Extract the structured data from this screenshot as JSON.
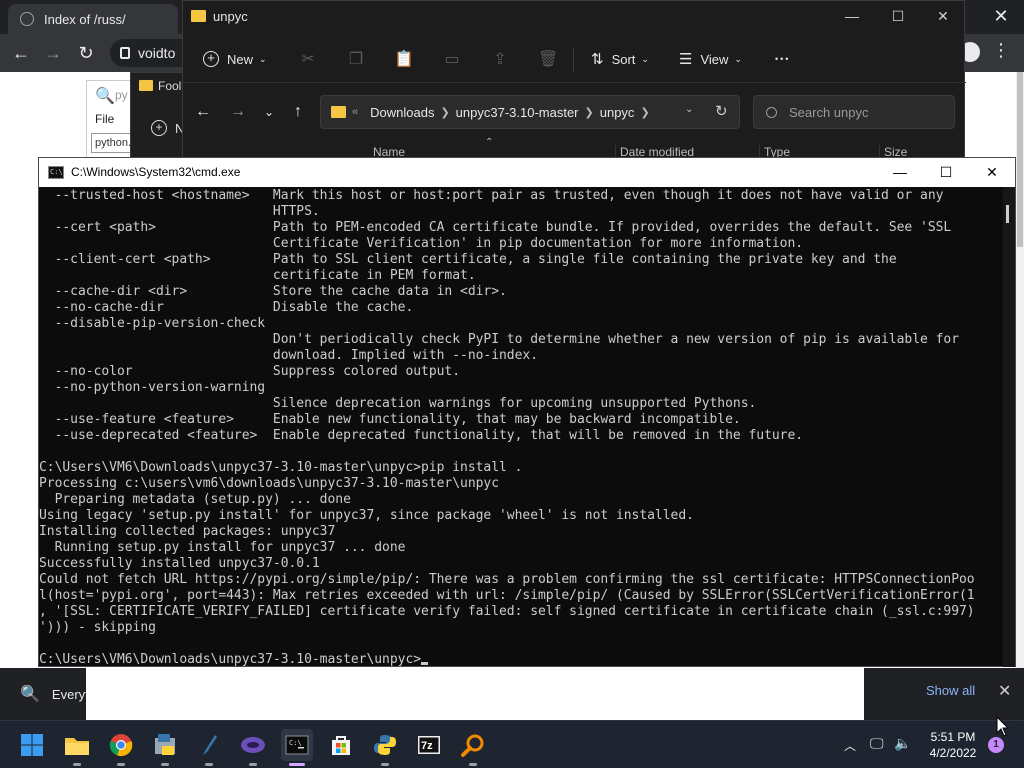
{
  "chrome": {
    "tab_title": "Index of /russ/",
    "address_text": "voidto",
    "close_glyph": "✕",
    "back_glyph": "←",
    "forward_glyph": "→",
    "reload_glyph": "↻",
    "kebab_glyph": "⋮"
  },
  "pyapp": {
    "title": "py",
    "menu_file": "File",
    "field_text": "python."
  },
  "fooapp": {
    "title": "Fool",
    "new_partial": "N"
  },
  "explorer": {
    "title": "unpyc",
    "new_label": "New",
    "sort_label": "Sort",
    "view_label": "View",
    "more_glyph": "•••",
    "breadcrumb_prefix": "«",
    "breadcrumb": [
      "Downloads",
      "unpyc37-3.10-master",
      "unpyc"
    ],
    "search_placeholder": "Search unpyc",
    "columns": [
      "Name",
      "Date modified",
      "Type",
      "Size"
    ],
    "minimize_glyph": "—",
    "maximize_glyph": "☐",
    "close_glyph": "✕"
  },
  "cmd": {
    "title": "C:\\Windows\\System32\\cmd.exe",
    "icon_text": "C:\\",
    "minimize_glyph": "—",
    "maximize_glyph": "☐",
    "close_glyph": "✕",
    "lines": [
      "  --trusted-host <hostname>   Mark this host or host:port pair as trusted, even though it does not have valid or any",
      "                              HTTPS.",
      "  --cert <path>               Path to PEM-encoded CA certificate bundle. If provided, overrides the default. See 'SSL",
      "                              Certificate Verification' in pip documentation for more information.",
      "  --client-cert <path>        Path to SSL client certificate, a single file containing the private key and the",
      "                              certificate in PEM format.",
      "  --cache-dir <dir>           Store the cache data in <dir>.",
      "  --no-cache-dir              Disable the cache.",
      "  --disable-pip-version-check",
      "                              Don't periodically check PyPI to determine whether a new version of pip is available for",
      "                              download. Implied with --no-index.",
      "  --no-color                  Suppress colored output.",
      "  --no-python-version-warning",
      "                              Silence deprecation warnings for upcoming unsupported Pythons.",
      "  --use-feature <feature>     Enable new functionality, that may be backward incompatible.",
      "  --use-deprecated <feature>  Enable deprecated functionality, that will be removed in the future.",
      "",
      "C:\\Users\\VM6\\Downloads\\unpyc37-3.10-master\\unpyc>pip install .",
      "Processing c:\\users\\vm6\\downloads\\unpyc37-3.10-master\\unpyc",
      "  Preparing metadata (setup.py) ... done",
      "Using legacy 'setup.py install' for unpyc37, since package 'wheel' is not installed.",
      "Installing collected packages: unpyc37",
      "  Running setup.py install for unpyc37 ... done",
      "Successfully installed unpyc37-0.0.1",
      "Could not fetch URL https://pypi.org/simple/pip/: There was a problem confirming the ssl certificate: HTTPSConnectionPoo",
      "l(host='pypi.org', port=443): Max retries exceeded with url: /simple/pip/ (Caused by SSLError(SSLCertVerificationError(1",
      ", '[SSL: CERTIFICATE_VERIFY_FAILED] certificate verify failed: self signed certificate in certificate chain (_ssl.c:997)",
      "'))) - skipping",
      "",
      "C:\\Users\\VM6\\Downloads\\unpyc37-3.10-master\\unpyc>"
    ]
  },
  "downloads_bar": {
    "item_label": "Everyth",
    "show_all": "Show all",
    "close_glyph": "✕"
  },
  "taskbar": {
    "clock_time": "5:51 PM",
    "clock_date": "4/2/2022",
    "notification_count": "1",
    "apps": [
      "start-icon",
      "file-explorer-icon",
      "chrome-icon",
      "python-installer-icon",
      "python-idle-icon",
      "visual-studio-icon",
      "terminal-icon",
      "store-icon",
      "python-icon",
      "7zip-icon",
      "everything-search-icon"
    ],
    "colors": {
      "taskbar_bg": "#1f2530",
      "active_indicator": "#d6a8ff",
      "start_blue": "#3b9cf2"
    }
  }
}
